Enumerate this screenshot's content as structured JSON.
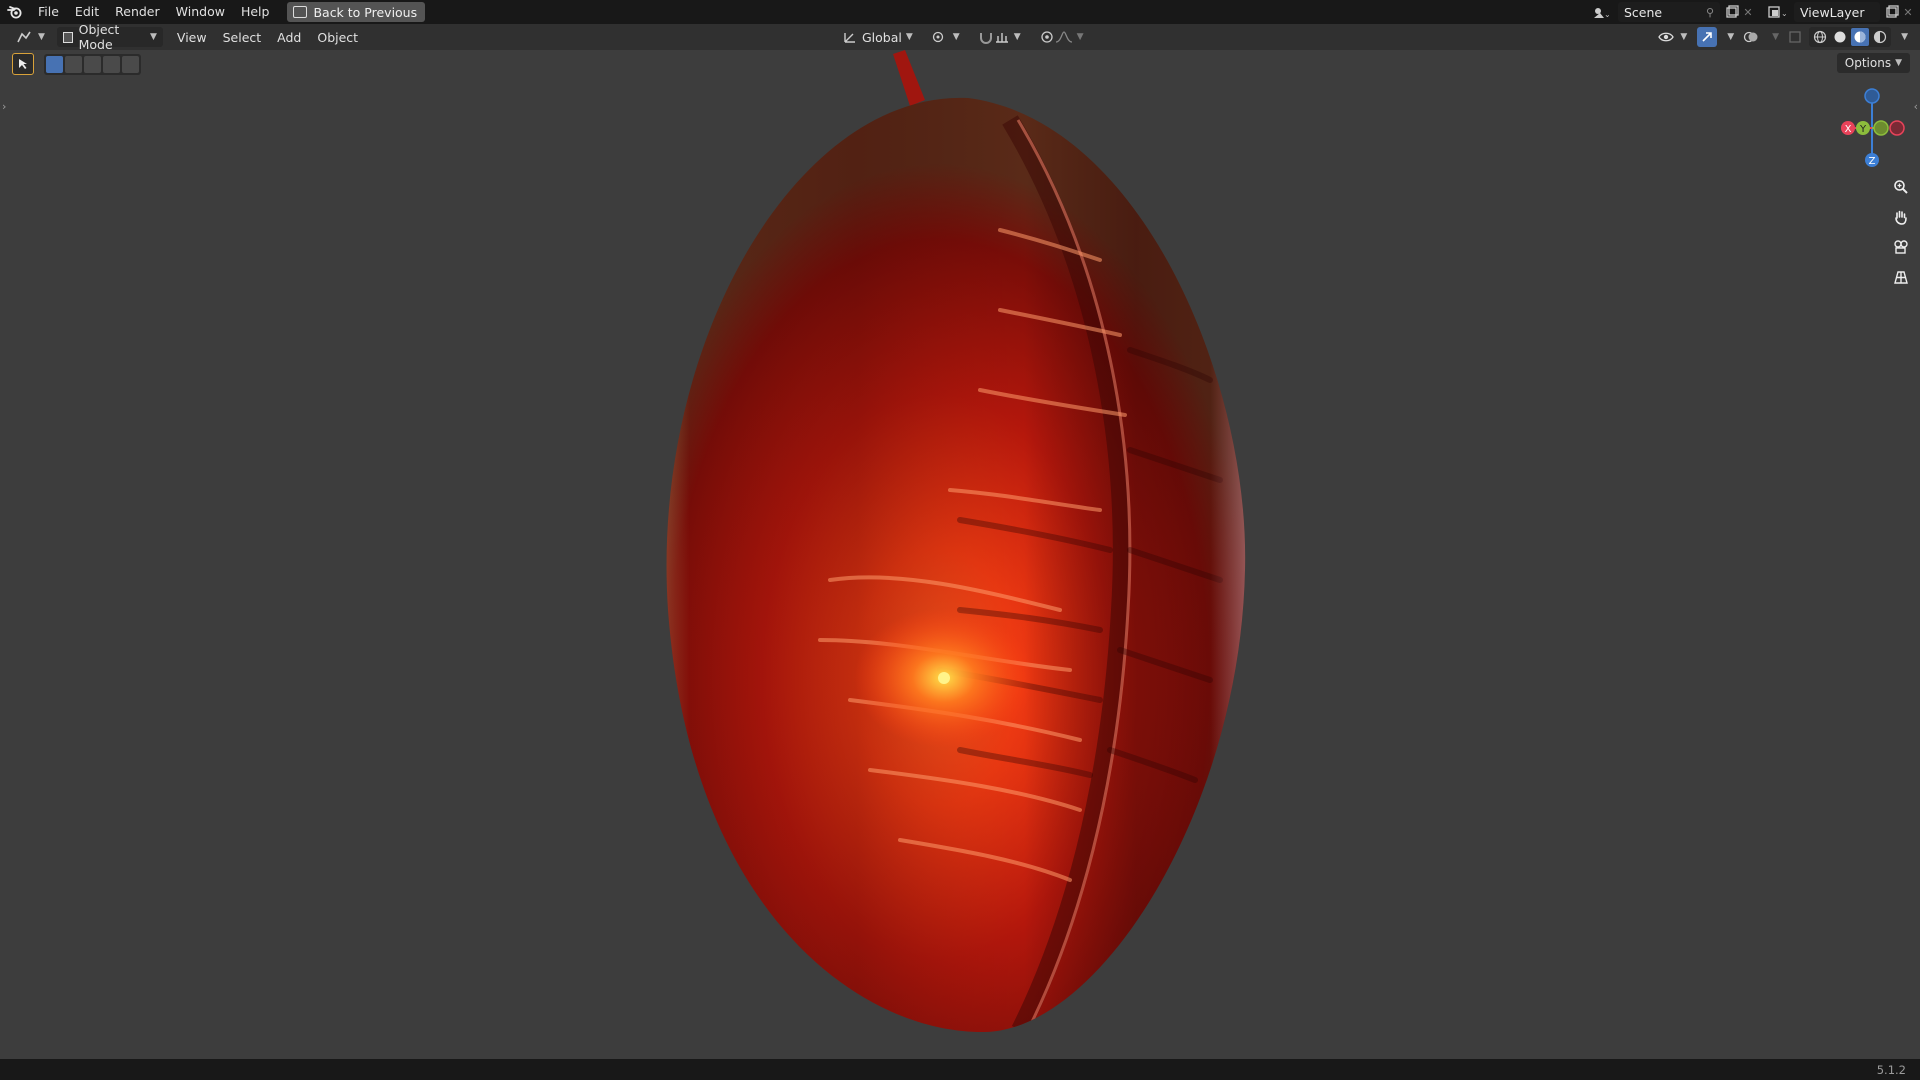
{
  "topbar": {
    "menus": [
      "File",
      "Edit",
      "Render",
      "Window",
      "Help"
    ],
    "back_label": "Back to Previous",
    "scene_name": "Scene",
    "view_layer": "ViewLayer"
  },
  "header": {
    "mode_label": "Object Mode",
    "menus": [
      "View",
      "Select",
      "Add",
      "Object"
    ],
    "transform_orientation": "Global",
    "options_label": "Options"
  },
  "gizmo": {
    "x_label": "X",
    "y_label": "Y",
    "z_label": "Z"
  },
  "status": {
    "version": "5.1.2"
  },
  "colors": {
    "x_axis": "#e8435a",
    "y_axis": "#8cbd3c",
    "z_axis": "#3c7fd6",
    "accent": "#4772b3"
  },
  "icons": {
    "logo": "blender-logo-icon",
    "zoom": "zoom-icon",
    "pan": "hand-icon",
    "camera": "camera-icon",
    "ortho": "grid-icon"
  }
}
